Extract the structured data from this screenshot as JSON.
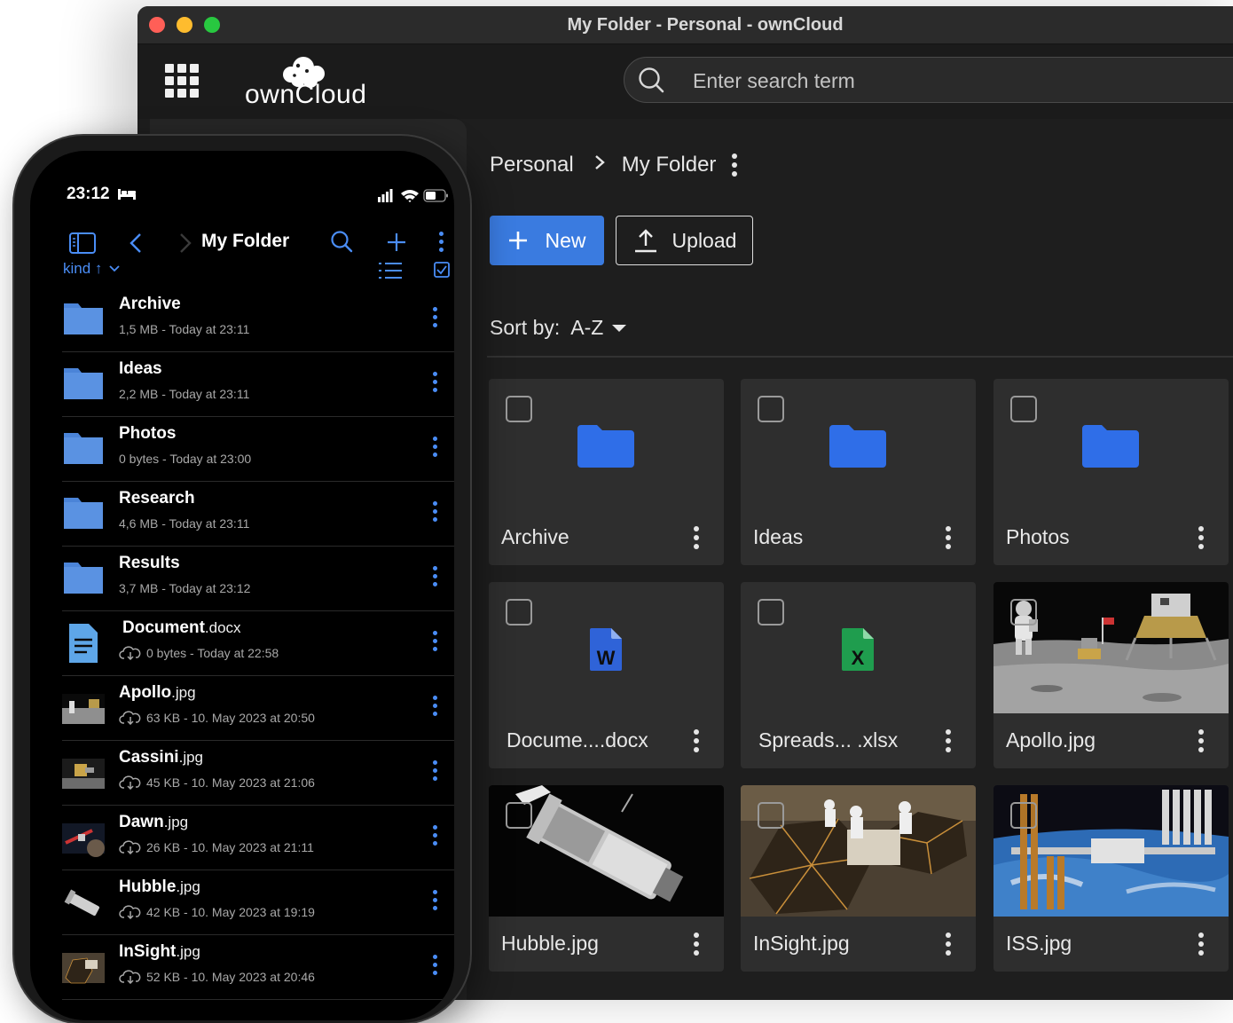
{
  "window": {
    "title": "My Folder - Personal - ownCloud"
  },
  "header": {
    "logo_text": "ownCloud",
    "search_placeholder": "Enter search term"
  },
  "breadcrumb": {
    "root": "Personal",
    "current": "My Folder",
    "separator": ">"
  },
  "toolbar": {
    "new_label": "New",
    "upload_label": "Upload"
  },
  "sort": {
    "label": "Sort by:",
    "value": "A-Z"
  },
  "tiles": [
    {
      "name": "Archive",
      "kind": "folder"
    },
    {
      "name": "Ideas",
      "kind": "folder"
    },
    {
      "name": "Photos",
      "kind": "folder"
    },
    {
      "name": "Docume....docx",
      "kind": "word"
    },
    {
      "name": "Spreads... .xlsx",
      "kind": "excel"
    },
    {
      "name": "Apollo.jpg",
      "kind": "image",
      "icon": "moon-landing-image"
    },
    {
      "name": "Hubble.jpg",
      "kind": "image",
      "icon": "hubble-telescope-image"
    },
    {
      "name": "InSight.jpg",
      "kind": "image",
      "icon": "insight-lander-image"
    },
    {
      "name": "ISS.jpg",
      "kind": "image",
      "icon": "space-station-image"
    }
  ],
  "colors": {
    "accent": "#3a7be0",
    "folder": "#2f6ee8",
    "phone_accent": "#4a8df6",
    "word": "#2f63d8",
    "excel": "#1f9d4e"
  },
  "phone": {
    "time": "23:12",
    "title": "My Folder",
    "sort_label": "kind ↑",
    "items": [
      {
        "name": "Archive",
        "ext": "",
        "meta": "1,5 MB - Today at 23:11",
        "kind": "folder"
      },
      {
        "name": "Ideas",
        "ext": "",
        "meta": "2,2 MB - Today at 23:11",
        "kind": "folder"
      },
      {
        "name": "Photos",
        "ext": "",
        "meta": "0 bytes - Today at 23:00",
        "kind": "folder"
      },
      {
        "name": "Research",
        "ext": "",
        "meta": "4,6 MB - Today at 23:11",
        "kind": "folder"
      },
      {
        "name": "Results",
        "ext": "",
        "meta": "3,7 MB - Today at 23:12",
        "kind": "folder"
      },
      {
        "name": "Document",
        "ext": ".docx",
        "meta": "0 bytes - Today at 22:58",
        "kind": "document"
      },
      {
        "name": "Apollo",
        "ext": ".jpg",
        "meta": "63 KB - 10. May 2023 at 20:50",
        "kind": "image"
      },
      {
        "name": "Cassini",
        "ext": ".jpg",
        "meta": "45 KB - 10. May 2023 at 21:06",
        "kind": "image"
      },
      {
        "name": "Dawn",
        "ext": ".jpg",
        "meta": "26 KB - 10. May 2023 at 21:11",
        "kind": "image"
      },
      {
        "name": "Hubble",
        "ext": ".jpg",
        "meta": "42 KB - 10. May 2023 at 19:19",
        "kind": "image"
      },
      {
        "name": "InSight",
        "ext": ".jpg",
        "meta": "52 KB - 10. May 2023 at 20:46",
        "kind": "image"
      }
    ]
  }
}
